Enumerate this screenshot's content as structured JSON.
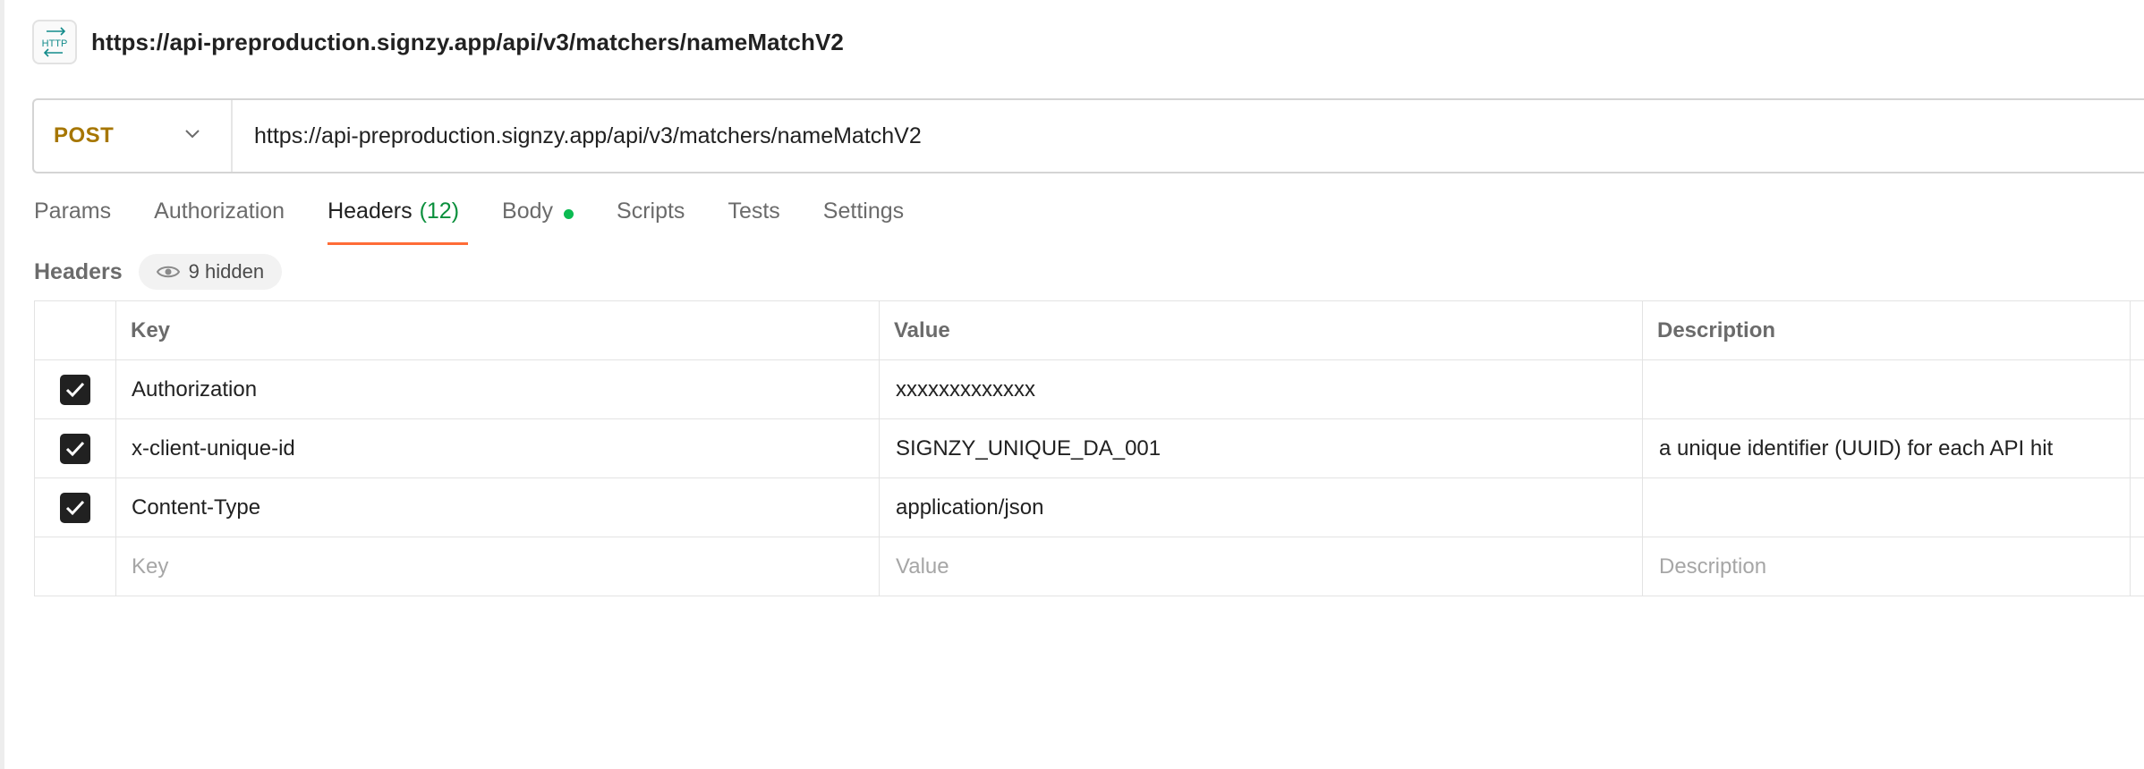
{
  "request": {
    "title": "https://api-preproduction.signzy.app/api/v3/matchers/nameMatchV2",
    "badge_icon": "http-icon",
    "method": "POST",
    "method_color": "#a67600",
    "url": "https://api-preproduction.signzy.app/api/v3/matchers/nameMatchV2"
  },
  "tabs": [
    {
      "label": "Params"
    },
    {
      "label": "Authorization"
    },
    {
      "label": "Headers",
      "count": "(12)",
      "active": true
    },
    {
      "label": "Body",
      "indicator": "green-dot"
    },
    {
      "label": "Scripts"
    },
    {
      "label": "Tests"
    },
    {
      "label": "Settings"
    }
  ],
  "headers_section": {
    "label": "Headers",
    "hidden_label": "9 hidden",
    "hidden_icon": "eye-icon"
  },
  "table": {
    "columns": {
      "key": "Key",
      "value": "Value",
      "description": "Description"
    },
    "rows": [
      {
        "checked": true,
        "key": "Authorization",
        "value": "xxxxxxxxxxxxx",
        "description": ""
      },
      {
        "checked": true,
        "key": "x-client-unique-id",
        "value": "SIGNZY_UNIQUE_DA_001",
        "description": "a unique identifier (UUID) for each API hit"
      },
      {
        "checked": true,
        "key": "Content-Type",
        "value": "application/json",
        "description": ""
      }
    ],
    "placeholders": {
      "key": "Key",
      "value": "Value",
      "description": "Description"
    }
  },
  "colors": {
    "accent_tab": "#ff6c37",
    "count": "#0a8f3c",
    "dot": "#0cbb52"
  }
}
